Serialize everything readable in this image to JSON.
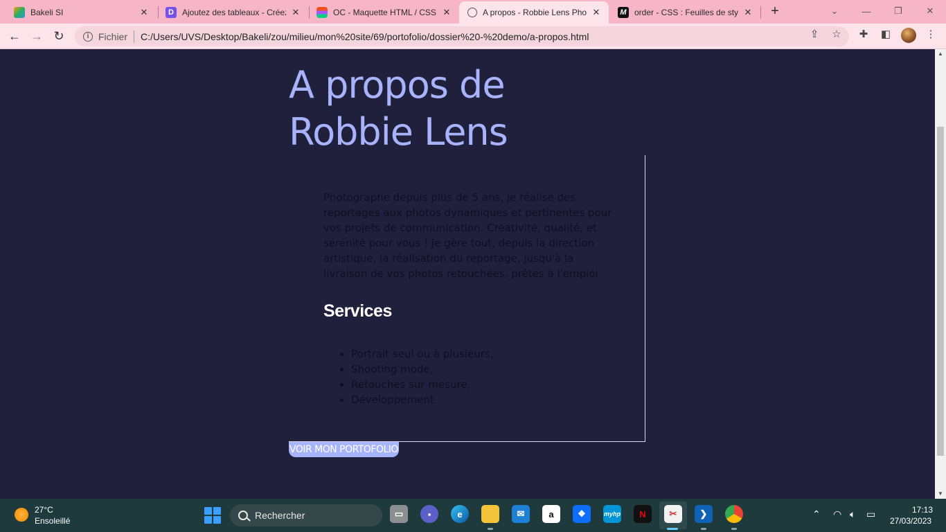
{
  "browser": {
    "tabs": [
      {
        "title": "Bakeli SI",
        "favicon": "bakeli-icon"
      },
      {
        "title": "Ajoutez des tableaux - Créez",
        "favicon": "openclassrooms-icon"
      },
      {
        "title": "OC - Maquette HTML / CSS c",
        "favicon": "figma-icon"
      },
      {
        "title": "A propos - Robbie Lens Phot",
        "favicon": "globe-icon"
      },
      {
        "title": "order - CSS : Feuilles de style",
        "favicon": "mdn-icon"
      }
    ],
    "address": {
      "scheme": "Fichier",
      "url": "C:/Users/UVS/Desktop/Bakeli/zou/milieu/mon%20site/69/portofolio/dossier%20-%20demo/a-propos.html"
    }
  },
  "page": {
    "title_line1": "A propos de",
    "title_line2": "Robbie Lens",
    "bio": "Photographe depuis plus de 5 ans, je réalise des reportages aux photos dynamiques et pertinentes pour vos projets de communication. Créativité, qualité, et sérénité pour vous ! Je gère tout, depuis la direction artistique, la réalisation du reportage, jusqu'à la livraison de vos photos retouchées, prêtes à l'emploi",
    "services_title": "Services",
    "services": [
      "Portrait seul ou à plusieurs,",
      "Shooting mode,",
      "Retouches sur mesure,",
      "Développement"
    ],
    "cta_label": "VOIR MON PORTOFOLIO"
  },
  "taskbar": {
    "weather_temp": "27°C",
    "weather_desc": "Ensoleillé",
    "search_placeholder": "Rechercher",
    "apps": [
      "file-manager-icon",
      "teams-icon",
      "edge-icon",
      "file-explorer-icon",
      "mail-icon",
      "amazon-icon",
      "dropbox-icon",
      "myhp-icon",
      "netflix-icon",
      "snipping-tool-icon",
      "vscode-icon",
      "chrome-icon"
    ],
    "time": "17:13",
    "date": "27/03/2023"
  },
  "colors": {
    "tab_strip": "#f7b6c8",
    "page_background": "#20203d",
    "accent": "#a7b3fb",
    "taskbar": "#1f3a3c"
  }
}
